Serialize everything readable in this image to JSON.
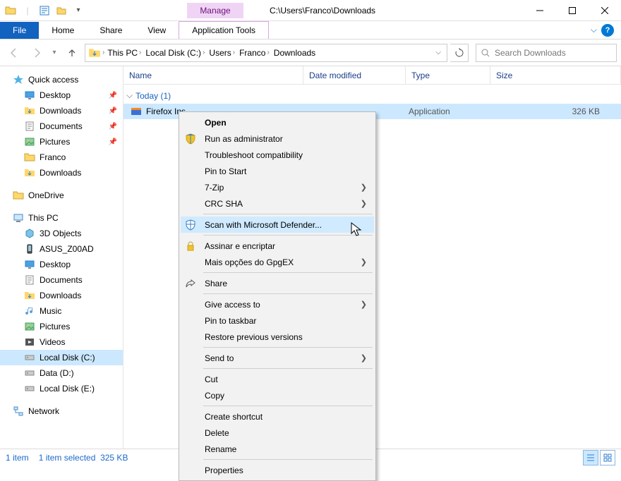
{
  "titlebar": {
    "manage_label": "Manage",
    "path_title": "C:\\Users\\Franco\\Downloads"
  },
  "ribbon": {
    "file": "File",
    "home": "Home",
    "share": "Share",
    "view": "View",
    "app_tools": "Application Tools"
  },
  "breadcrumbs": [
    "This PC",
    "Local Disk (C:)",
    "Users",
    "Franco",
    "Downloads"
  ],
  "search": {
    "placeholder": "Search Downloads"
  },
  "columns": {
    "name": "Name",
    "date": "Date modified",
    "type": "Type",
    "size": "Size"
  },
  "sidebar": {
    "quick_access": "Quick access",
    "qa_items": [
      {
        "label": "Desktop",
        "pin": true
      },
      {
        "label": "Downloads",
        "pin": true
      },
      {
        "label": "Documents",
        "pin": true
      },
      {
        "label": "Pictures",
        "pin": true
      },
      {
        "label": "Franco",
        "pin": false
      },
      {
        "label": "Downloads",
        "pin": false
      }
    ],
    "onedrive": "OneDrive",
    "this_pc": "This PC",
    "pc_items": [
      "3D Objects",
      "ASUS_Z00AD",
      "Desktop",
      "Documents",
      "Downloads",
      "Music",
      "Pictures",
      "Videos",
      "Local Disk (C:)",
      "Data (D:)",
      "Local Disk (E:)"
    ],
    "network": "Network"
  },
  "group": {
    "today_label": "Today (1)"
  },
  "file": {
    "name": "Firefox Installer.exe",
    "name_truncated": "Firefox Ins",
    "type": "Application",
    "size": "326 KB"
  },
  "status": {
    "count": "1 item",
    "selected": "1 item selected",
    "size": "325 KB"
  },
  "context_menu": [
    {
      "label": "Open",
      "bold": true
    },
    {
      "label": "Run as administrator",
      "icon": "shield"
    },
    {
      "label": "Troubleshoot compatibility"
    },
    {
      "label": "Pin to Start"
    },
    {
      "label": "7-Zip",
      "submenu": true
    },
    {
      "label": "CRC SHA",
      "submenu": true
    },
    {
      "sep": true
    },
    {
      "label": "Scan with Microsoft Defender...",
      "icon": "defender",
      "hover": true
    },
    {
      "sep": true
    },
    {
      "label": "Assinar e encriptar",
      "icon": "lock"
    },
    {
      "label": "Mais opções do GpgEX",
      "submenu": true
    },
    {
      "sep": true
    },
    {
      "label": "Share",
      "icon": "share"
    },
    {
      "sep": true
    },
    {
      "label": "Give access to",
      "submenu": true
    },
    {
      "label": "Pin to taskbar"
    },
    {
      "label": "Restore previous versions"
    },
    {
      "sep": true
    },
    {
      "label": "Send to",
      "submenu": true
    },
    {
      "sep": true
    },
    {
      "label": "Cut"
    },
    {
      "label": "Copy"
    },
    {
      "sep": true
    },
    {
      "label": "Create shortcut"
    },
    {
      "label": "Delete"
    },
    {
      "label": "Rename"
    },
    {
      "sep": true
    },
    {
      "label": "Properties"
    }
  ]
}
